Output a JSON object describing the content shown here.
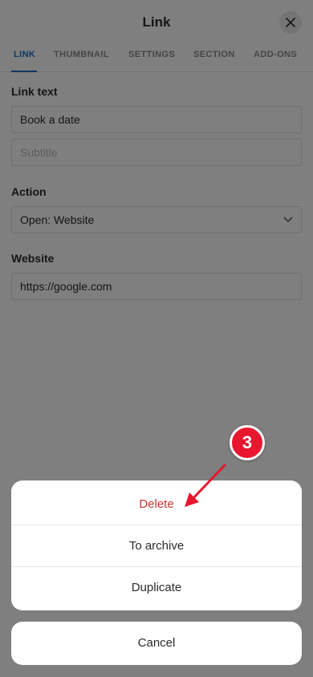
{
  "header": {
    "title": "Link"
  },
  "tabs": [
    {
      "label": "LINK",
      "active": true
    },
    {
      "label": "THUMBNAIL",
      "active": false
    },
    {
      "label": "SETTINGS",
      "active": false
    },
    {
      "label": "SECTION",
      "active": false
    },
    {
      "label": "ADD-ONS",
      "active": false
    }
  ],
  "form": {
    "link_text_label": "Link text",
    "link_text_value": "Book a date",
    "subtitle_placeholder": "Subtitle",
    "action_label": "Action",
    "action_value": "Open: Website",
    "website_label": "Website",
    "website_value": "https://google.com"
  },
  "action_sheet": {
    "items": [
      "Delete",
      "To archive",
      "Duplicate"
    ],
    "cancel_label": "Cancel"
  },
  "annotation": {
    "step_number": "3"
  },
  "colors": {
    "accent": "#1e6fc6",
    "danger": "#c6352d",
    "annotation": "#e8162e"
  }
}
